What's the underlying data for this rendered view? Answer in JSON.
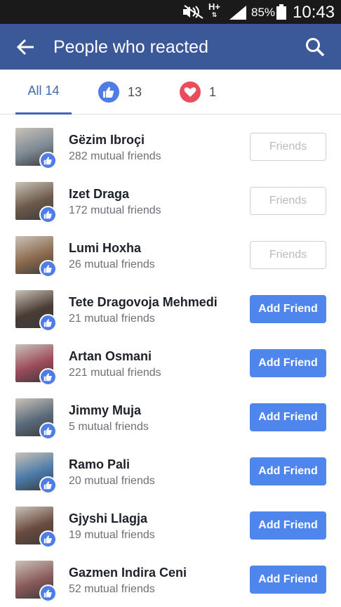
{
  "status_bar": {
    "network": "H+",
    "battery_percent": "85%",
    "time": "10:43",
    "icons": [
      "mute-icon",
      "signal-icon",
      "battery-icon"
    ]
  },
  "app_bar": {
    "title": "People who reacted",
    "back_icon": "back-arrow-icon",
    "search_icon": "search-icon"
  },
  "tabs": {
    "all_label": "All 14",
    "like_count": "13",
    "love_count": "1"
  },
  "colors": {
    "brand": "#3b5998",
    "accent": "#4267b2",
    "like": "#4e7de8",
    "love": "#ea4c5d",
    "button_add": "#4e86ee"
  },
  "people": [
    {
      "name": "Gëzim Ibroçi",
      "mutual": "282 mutual friends",
      "button": "Friends",
      "status": "friends",
      "avatar_color": "#7d8a95"
    },
    {
      "name": "Izet Draga",
      "mutual": "172 mutual friends",
      "button": "Friends",
      "status": "friends",
      "avatar_color": "#6b5a4a"
    },
    {
      "name": "Lumi Hoxha",
      "mutual": "26 mutual friends",
      "button": "Friends",
      "status": "friends",
      "avatar_color": "#8c6a4e"
    },
    {
      "name": "Tete Dragovoja Mehmedi",
      "mutual": "21 mutual friends",
      "button": "Add Friend",
      "status": "add",
      "avatar_color": "#4a3b35"
    },
    {
      "name": "Artan Osmani",
      "mutual": "221 mutual friends",
      "button": "Add Friend",
      "status": "add",
      "avatar_color": "#9c4a5a"
    },
    {
      "name": "Jimmy Muja",
      "mutual": "5 mutual friends",
      "button": "Add Friend",
      "status": "add",
      "avatar_color": "#5a6a7a"
    },
    {
      "name": "Ramo Pali",
      "mutual": "20 mutual friends",
      "button": "Add Friend",
      "status": "add",
      "avatar_color": "#4a7aa8"
    },
    {
      "name": "Gjyshi Llagja",
      "mutual": "19 mutual friends",
      "button": "Add Friend",
      "status": "add",
      "avatar_color": "#6a4a3e"
    },
    {
      "name": "Gazmen Indira Ceni",
      "mutual": "52 mutual friends",
      "button": "Add Friend",
      "status": "add",
      "avatar_color": "#8a5a5a"
    }
  ]
}
